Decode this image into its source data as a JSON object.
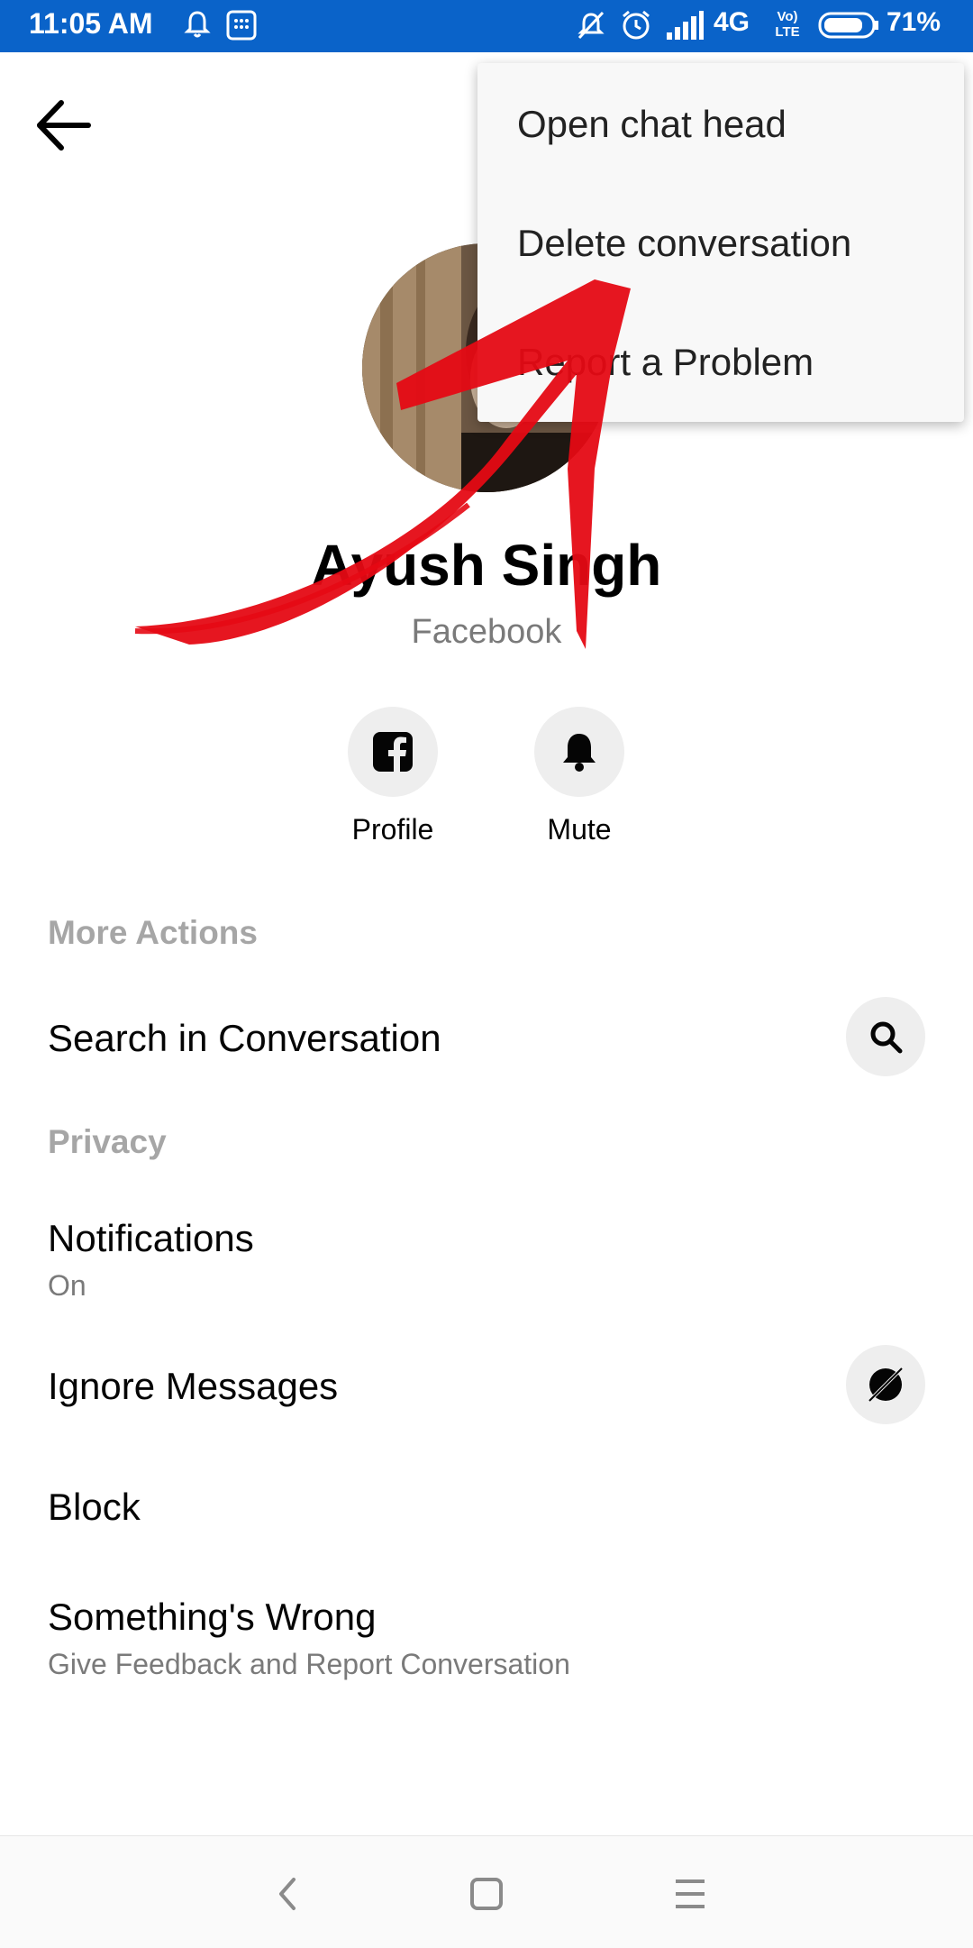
{
  "status_bar": {
    "time": "11:05 AM",
    "network": "4G",
    "volte": "Vo) LTE",
    "battery": "71%"
  },
  "header": {
    "back_icon": "arrow-left-icon"
  },
  "profile": {
    "name": "Ayush Singh",
    "subtitle": "Facebook",
    "actions": [
      {
        "label": "Profile",
        "icon": "facebook-icon"
      },
      {
        "label": "Mute",
        "icon": "bell-icon"
      }
    ]
  },
  "sections": {
    "more_actions": {
      "label": "More Actions",
      "search": {
        "title": "Search in Conversation",
        "icon": "search-icon"
      }
    },
    "privacy": {
      "label": "Privacy",
      "notifications": {
        "title": "Notifications",
        "subtitle": "On"
      },
      "ignore": {
        "title": "Ignore Messages",
        "icon": "ignore-icon"
      },
      "block": {
        "title": "Block"
      },
      "wrong": {
        "title": "Something's Wrong",
        "subtitle": "Give Feedback and Report Conversation"
      }
    }
  },
  "overflow_menu": {
    "items": [
      "Open chat head",
      "Delete conversation",
      "Report a Problem"
    ]
  },
  "annotation": {
    "color": "#e50914"
  },
  "nav_bar": {
    "buttons": [
      "back-nav-icon",
      "home-nav-icon",
      "recents-nav-icon"
    ]
  }
}
